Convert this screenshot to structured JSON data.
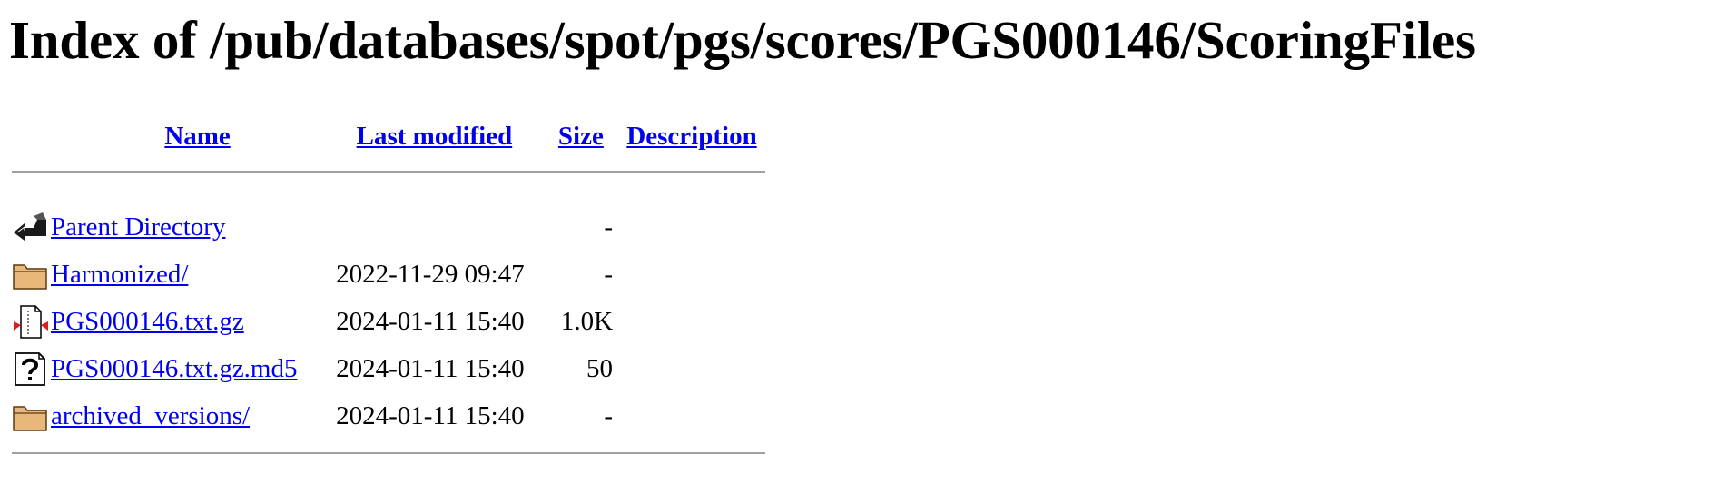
{
  "page": {
    "heading": "Index of /pub/databases/spot/pgs/scores/PGS000146/ScoringFiles"
  },
  "columns": {
    "name": "Name",
    "last_modified": "Last modified",
    "size": "Size",
    "description": "Description"
  },
  "rows": [
    {
      "icon": "back-arrow-icon",
      "name": "Parent Directory",
      "modified": "",
      "size": "-",
      "description": ""
    },
    {
      "icon": "folder-icon",
      "name": "Harmonized/",
      "modified": "2022-11-29 09:47",
      "size": "-",
      "description": ""
    },
    {
      "icon": "compressed-file-icon",
      "name": "PGS000146.txt.gz",
      "modified": "2024-01-11 15:40",
      "size": "1.0K",
      "description": ""
    },
    {
      "icon": "unknown-file-icon",
      "name": "PGS000146.txt.gz.md5",
      "modified": "2024-01-11 15:40",
      "size": "50",
      "description": ""
    },
    {
      "icon": "folder-icon",
      "name": "archived_versions/",
      "modified": "2024-01-11 15:40",
      "size": "-",
      "description": ""
    }
  ],
  "colors": {
    "link": "#0000ee",
    "rule": "#a0a0a0",
    "folder_fill": "#e8b77a"
  }
}
